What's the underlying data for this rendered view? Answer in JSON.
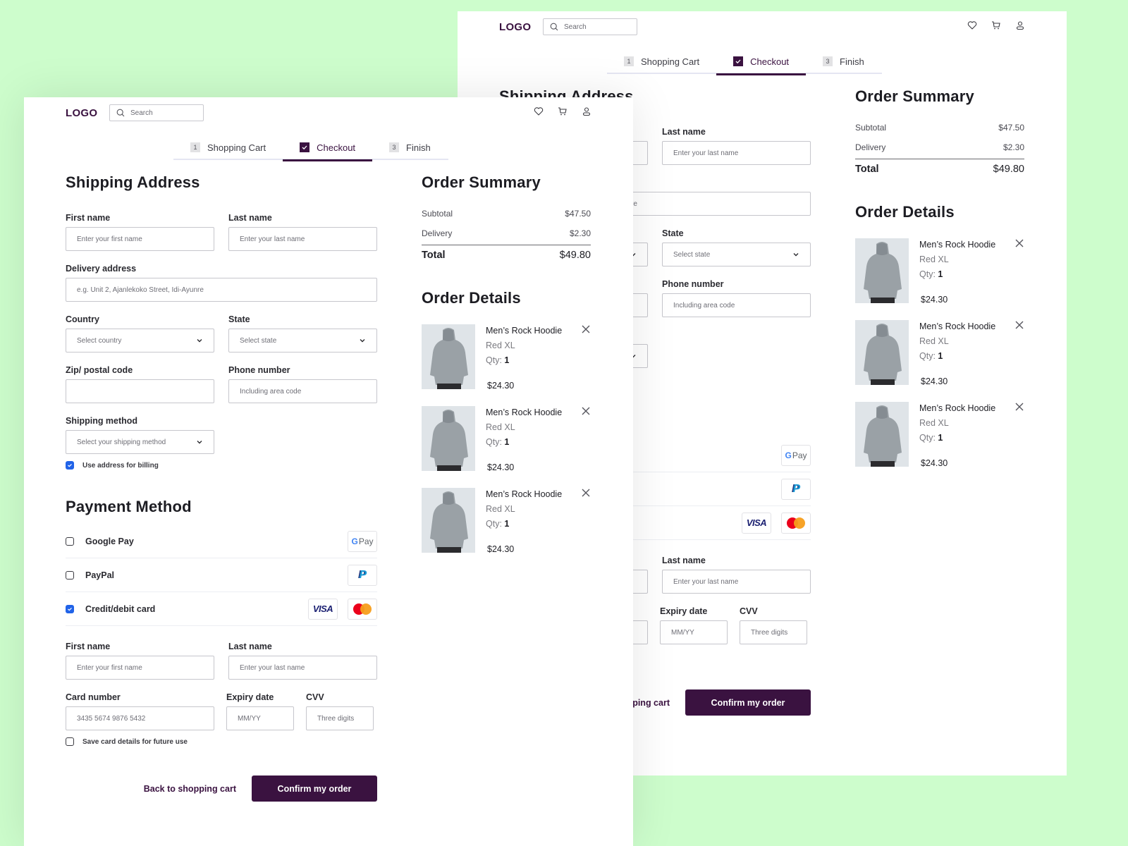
{
  "header": {
    "logo": "LOGO",
    "search_placeholder": "Search",
    "icons": [
      "heart-icon",
      "cart-icon",
      "user-icon"
    ]
  },
  "stepper": [
    {
      "num": "1",
      "label": "Shopping Cart",
      "state": "pending"
    },
    {
      "num": "",
      "label": "Checkout",
      "state": "active"
    },
    {
      "num": "3",
      "label": "Finish",
      "state": "pending"
    }
  ],
  "shipping": {
    "title": "Shipping Address",
    "first_name_label": "First name",
    "first_name_placeholder": "Enter your first name",
    "last_name_label": "Last name",
    "last_name_placeholder": "Enter your last name",
    "address_label": "Delivery address",
    "address_placeholder": "e.g. Unit 2, Ajanlekoko Street, Idi-Ayunre",
    "country_label": "Country",
    "country_value": "Select country",
    "state_label": "State",
    "state_value": "Select state",
    "zip_label": "Zip/ postal code",
    "zip_value": "",
    "phone_label": "Phone number",
    "phone_placeholder": "Including area code",
    "method_label": "Shipping method",
    "method_value": "Select your shipping method",
    "billing_label": "Use address for billing",
    "billing_checked": true
  },
  "payment": {
    "title": "Payment Method",
    "options": [
      {
        "label": "Google Pay",
        "checked": false,
        "logo": "gpay"
      },
      {
        "label": "PayPal",
        "checked": false,
        "logo": "paypal"
      },
      {
        "label": "Credit/debit card",
        "checked": true,
        "logo": "visa-mastercard"
      }
    ],
    "gpay_g": "G",
    "gpay_text": "Pay",
    "visa_text": "VISA",
    "first_name_label": "First name",
    "first_name_placeholder": "Enter your first name",
    "last_name_label": "Last name",
    "last_name_placeholder": "Enter your last name",
    "card_label": "Card number",
    "card_placeholder": "3435 5674 9876 5432",
    "expiry_label": "Expiry date",
    "expiry_placeholder": "MM/YY",
    "cvv_label": "CVV",
    "cvv_placeholder": "Three digits",
    "save_label": "Save card details for future use",
    "save_checked": false
  },
  "actions": {
    "back_label": "Back to shopping cart",
    "confirm_label": "Confirm my order"
  },
  "summary": {
    "title": "Order Summary",
    "subtotal_label": "Subtotal",
    "subtotal": "$47.50",
    "delivery_label": "Delivery",
    "delivery": "$2.30",
    "total_label": "Total",
    "total": "$49.80"
  },
  "details": {
    "title": "Order Details",
    "qty_label": "Qty:",
    "items": [
      {
        "name": "Men’s Rock Hoodie",
        "variant": "Red XL",
        "qty": "1",
        "price": "$24.30"
      },
      {
        "name": "Men’s Rock Hoodie",
        "variant": "Red XL",
        "qty": "1",
        "price": "$24.30"
      },
      {
        "name": "Men’s Rock Hoodie",
        "variant": "Red XL",
        "qty": "1",
        "price": "$24.30"
      }
    ]
  },
  "colors": {
    "brand": "#3a1240",
    "checkbox_on": "#2163e8",
    "background": "#cdfdcc"
  }
}
